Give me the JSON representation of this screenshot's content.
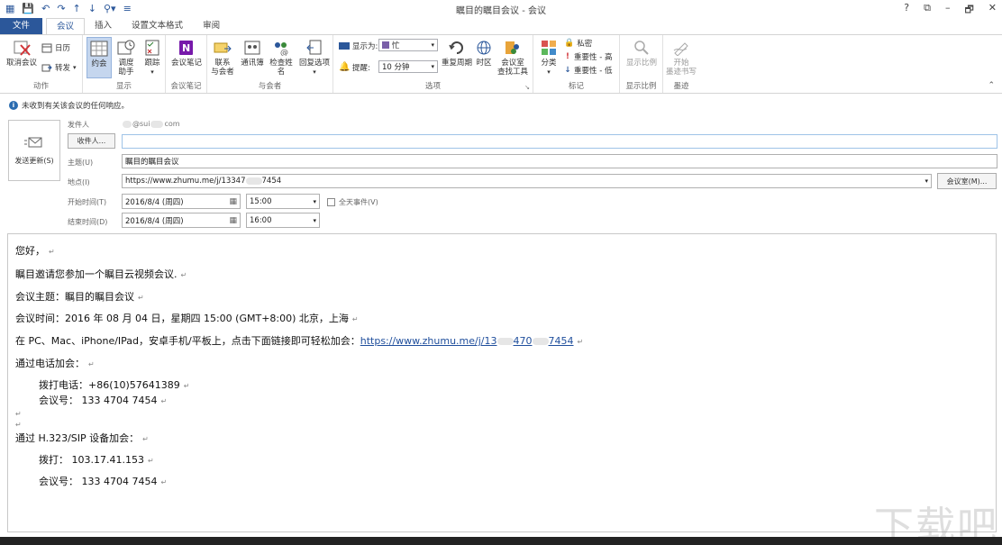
{
  "window": {
    "title": "瞩目的瞩目会议 - 会议",
    "controls": [
      "?",
      "⧉",
      "–",
      "🗗",
      "✕"
    ]
  },
  "tabs": [
    "文件",
    "会议",
    "插入",
    "设置文本格式",
    "审阅"
  ],
  "ribbon": {
    "actions": {
      "label": "动作",
      "cancel": "取消会议",
      "calendar": "日历",
      "forward": "转发"
    },
    "show": {
      "label": "显示",
      "appointment": "约会",
      "scheduling": "调度\n助手",
      "tracking": "跟踪"
    },
    "notes": {
      "label": "会议笔记",
      "meeting_notes": "会议笔记"
    },
    "attendees": {
      "label": "与会者",
      "contact": "联系\n与会者",
      "address_book": "通讯簿",
      "check_names": "检查姓名",
      "response_options": "回复选项"
    },
    "options": {
      "label": "选项",
      "show_as_label": "显示为:",
      "show_as_value": "忙",
      "reminder_label": "提醒:",
      "reminder_value": "10 分钟",
      "recurrence": "重复周期",
      "time_zones": "时区",
      "room_finder": "会议室\n查找工具"
    },
    "tags": {
      "label": "标记",
      "categorize": "分类",
      "private": "私密",
      "high_importance": "重要性 - 高",
      "low_importance": "重要性 - 低"
    },
    "zoom": {
      "label": "显示比例",
      "zoom": "显示比例"
    },
    "ink": {
      "label": "墨迹",
      "start_inking": "开始\n墨迹书写"
    }
  },
  "infobar": "未收到有关该会议的任何响应。",
  "form": {
    "send_update": "发送更新(S)",
    "from_label": "发件人",
    "from_value_prefix": "",
    "from_value_mid": "@sui",
    "from_value_suffix": "com",
    "to_button": "收件人...",
    "to_value": "",
    "subject_label": "主题(U)",
    "subject_value": "瞩目的瞩目会议",
    "location_label": "地点(I)",
    "location_value_a": "https://www.zhumu.me/j/13347",
    "location_value_b": "7454",
    "rooms_button": "会议室(M)...",
    "start_label": "开始时间(T)",
    "start_date": "2016/8/4 (周四)",
    "start_time": "15:00",
    "all_day": "全天事件(V)",
    "end_label": "结束时间(D)",
    "end_date": "2016/8/4 (周四)",
    "end_time": "16:00"
  },
  "body": {
    "greeting": "您好，",
    "invite": "瞩目邀请您参加一个瞩目云视频会议.",
    "topic": "会议主题：瞩目的瞩目会议",
    "time": "会议时间：2016 年 08 月 04 日，星期四 15:00 (GMT+8:00) 北京，上海",
    "join_text": "在 PC、Mac、iPhone/IPad，安卓手机/平板上，点击下面链接即可轻松加会：",
    "join_link_a": "https://www.zhumu.me/j/13",
    "join_link_b": "470",
    "join_link_c": "7454",
    "phone_heading": "通过电话加会：",
    "dial_phone": "拨打电话：+86(10)57641389",
    "meeting_id_1": "会议号：  133 4704 7454",
    "h323_heading": "通过 H.323/SIP 设备加会：",
    "dial_ip": "拨打：  103.17.41.153",
    "meeting_id_2": "会议号：  133 4704 7454",
    "para_mark": "↵"
  },
  "watermark": "下载吧"
}
